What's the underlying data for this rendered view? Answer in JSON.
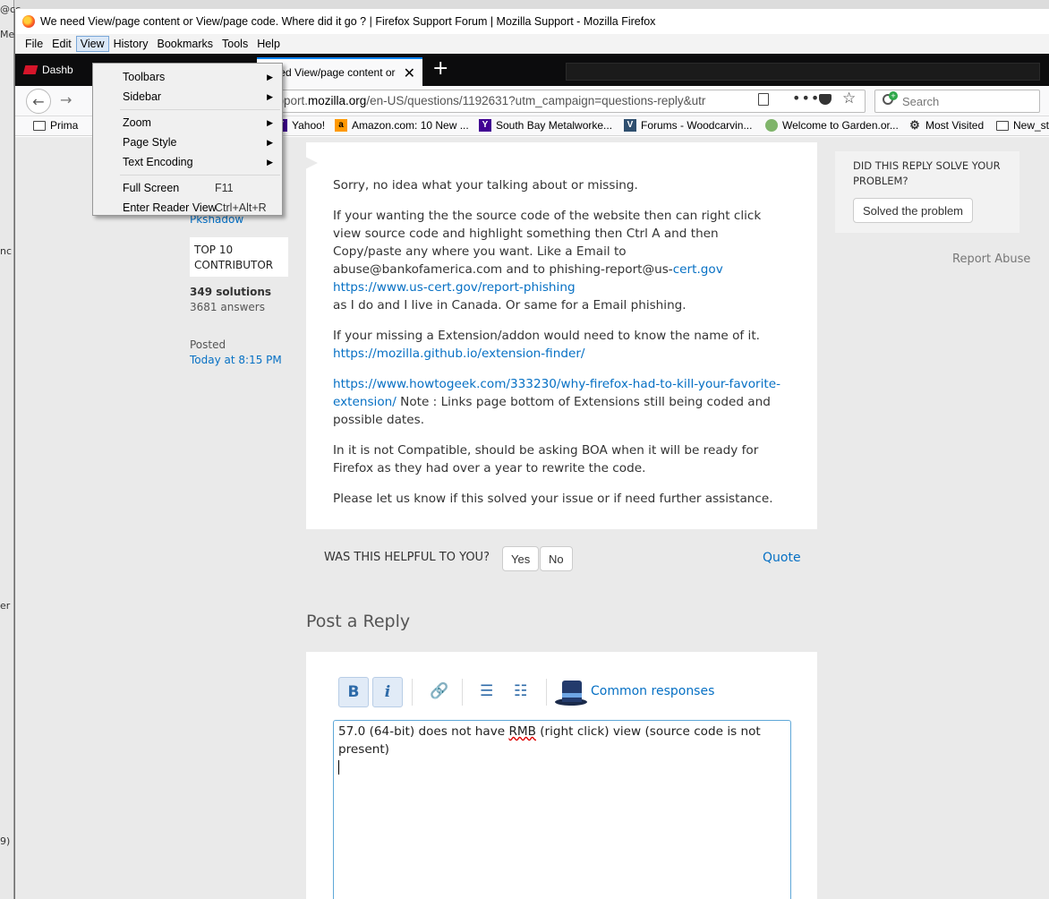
{
  "background": {
    "left_fragments": [
      "@cc",
      "Me",
      "nc",
      "er",
      "9)"
    ]
  },
  "window": {
    "title": "We need View/page content or View/page code. Where did it go ? | Firefox Support Forum | Mozilla Support - Mozilla Firefox"
  },
  "menubar": {
    "items": [
      "File",
      "Edit",
      "View",
      "History",
      "Bookmarks",
      "Tools",
      "Help"
    ]
  },
  "tabs": {
    "inactive_label": "Dashb",
    "active_label": "need View/page content or",
    "new_tab_glyph": "+"
  },
  "navbar": {
    "url_prefix": "upport.",
    "url_host": "mozilla.org",
    "url_rest": "/en-US/questions/1192631?utm_campaign=questions-reply&utr",
    "search_placeholder": "Search"
  },
  "bookmarks": [
    {
      "label": "Prima",
      "icon": "folder-icon"
    },
    {
      "label": "Yahoo!",
      "icon": "yahoo-icon"
    },
    {
      "label": "Amazon.com: 10 New ...",
      "icon": "amazon-icon"
    },
    {
      "label": "South Bay Metalworke...",
      "icon": "yahoo-icon"
    },
    {
      "label": "Forums - Woodcarvin...",
      "icon": "vb-icon"
    },
    {
      "label": "Welcome to Garden.or...",
      "icon": "garden-icon"
    },
    {
      "label": "Most Visited",
      "icon": "gear-icon"
    },
    {
      "label": "New_stu",
      "icon": "folder-icon"
    }
  ],
  "view_menu": {
    "toolbars": "Toolbars",
    "sidebar": "Sidebar",
    "zoom": "Zoom",
    "page_style": "Page Style",
    "text_encoding": "Text Encoding",
    "full_screen": "Full Screen",
    "full_screen_shortcut": "F11",
    "reader_view": "Enter Reader View",
    "reader_view_shortcut": "Ctrl+Alt+R"
  },
  "author": {
    "name": "Pkshadow",
    "badge": "TOP 10 CONTRIBUTOR",
    "solutions": "349 solutions",
    "answers": "3681 answers",
    "posted_label": "Posted",
    "posted_time": "Today at 8:15 PM"
  },
  "answer": {
    "p1": "Sorry, no idea what your talking about or missing.",
    "p2a": "If your wanting the the source code of the website then can right click view source code and highlight something then Ctrl A and then Copy/paste any where you want. Like a Email to abuse@bankofamerica.com and to  phishing-report@us-",
    "p2_link1": "cert.gov",
    "p2_link2": "https://www.us-cert.gov/report-phishing",
    "p2b": "as I do and I live in Canada. Or same for a Email phishing.",
    "p3": "If your missing a Extension/addon would need to know the name of it.",
    "p3_link": "https://mozilla.github.io/extension-finder/",
    "p4_link": "https://www.howtogeek.com/333230/why-firefox-had-to-kill-your-favorite-extension/",
    "p4": " Note : Links page bottom of Extensions still being coded and possible dates.",
    "p5": "In it is not Compatible, should be asking BOA  when it will be ready for Firefox as they had over a year to rewrite the code.",
    "p6": "Please let us know if this solved your issue or if need further assistance."
  },
  "helpful": {
    "question": "WAS THIS HELPFUL TO YOU?",
    "yes": "Yes",
    "no": "No",
    "quote": "Quote"
  },
  "reply": {
    "heading": "Post a Reply",
    "bold": "B",
    "italic": "i",
    "common_responses": "Common responses",
    "text_before": "57.0 (64-bit) does not have ",
    "text_misspelled": "RMB",
    "text_after": " (right click) view (source code is not present)"
  },
  "sidebar": {
    "question": "DID THIS REPLY SOLVE YOUR PROBLEM?",
    "solved_button": "Solved the problem",
    "report": "Report Abuse"
  }
}
